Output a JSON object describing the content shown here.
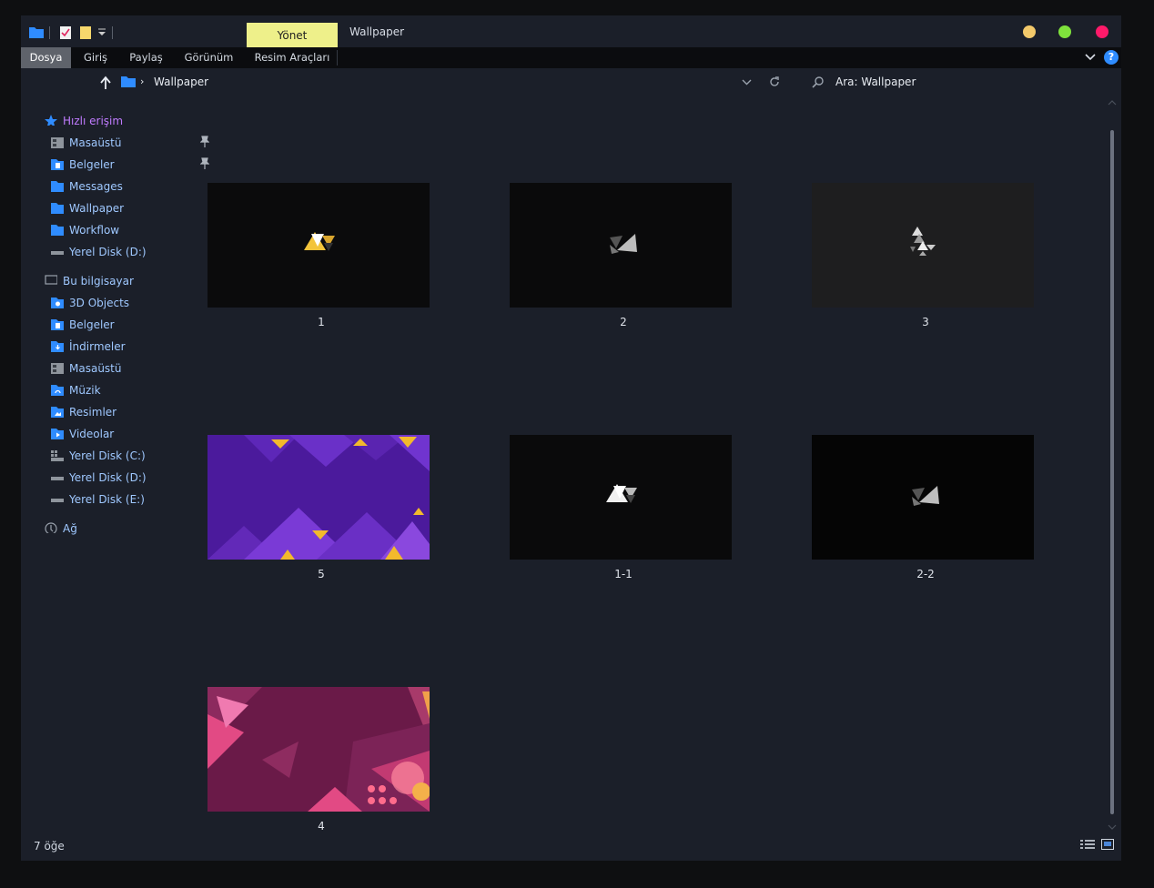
{
  "titlebar": {
    "context_tab": "Yönet",
    "title": "Wallpaper",
    "btn_colors": [
      "#f3c96a",
      "#7fe23c",
      "#ff1a6a"
    ]
  },
  "ribbon": {
    "tabs": [
      "Dosya",
      "Giriş",
      "Paylaş",
      "Görünüm",
      "Resim Araçları"
    ]
  },
  "address": {
    "crumb": "Wallpaper",
    "search_placeholder": "Ara: Wallpaper"
  },
  "nav": {
    "quick_access": "Hızlı erişim",
    "quick": [
      "Masaüstü",
      "Belgeler",
      "Messages",
      "Wallpaper",
      "Workflow",
      "Yerel Disk (D:)"
    ],
    "this_pc": "Bu bilgisayar",
    "pc": [
      "3D Objects",
      "Belgeler",
      "İndirmeler",
      "Masaüstü",
      "Müzik",
      "Resimler",
      "Videolar",
      "Yerel Disk (C:)",
      "Yerel Disk (D:)",
      "Yerel Disk (E:)"
    ],
    "network": "Ağ"
  },
  "files": [
    "1",
    "2",
    "3",
    "5",
    "1-1",
    "2-2",
    "4"
  ],
  "status": {
    "count": "7 öğe"
  },
  "accent": "#2f8cff"
}
